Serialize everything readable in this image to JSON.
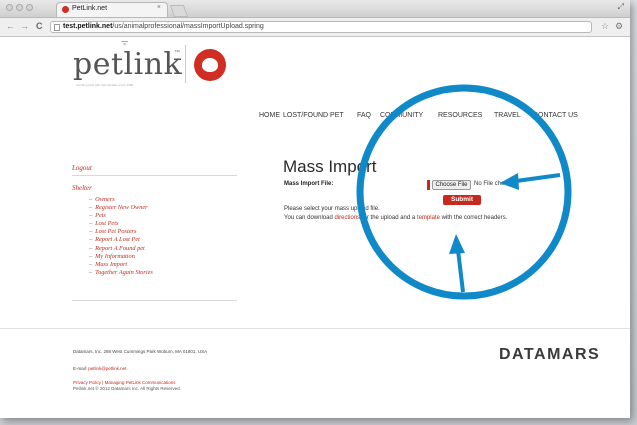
{
  "browser": {
    "tab_title": "PetLink.net",
    "tab_close": "×",
    "window_control": "⤢",
    "url_host": "test.petlink.net",
    "url_path": "/us/animalprofessional/massImportUpload.spring",
    "back_icon": "←",
    "forward_icon": "→",
    "reload_icon": "C",
    "star_icon": "☆",
    "wrench_icon": "⚙"
  },
  "site": {
    "logo_text": "petlink",
    "logo_tm": "™",
    "logo_tagline": "reuniting pets with their families since 1985",
    "brand_color": "#c8291e"
  },
  "nav": {
    "items": [
      "HOME",
      "LOST/FOUND PET",
      "FAQ",
      "COMMUNITY",
      "RESOURCES",
      "TRAVEL",
      "CONTACT US"
    ]
  },
  "sidebar": {
    "logout": "Logout",
    "shelter": "Shelter",
    "items": [
      "Owners",
      "Register New Owner",
      "Pets",
      "Lost Pets",
      "Lost Pet Posters",
      "Report A Lost Pet",
      "Report A Found pet",
      "My Information",
      "Mass Import",
      "Together Again Stories"
    ]
  },
  "main": {
    "title": "Mass Import",
    "field_label": "Mass Import File:",
    "choose_file": "Choose File",
    "no_file": "No File chosen",
    "submit": "Submit",
    "help_line1": "Please select your mass upload file.",
    "help_line2_pre": "You can download ",
    "help_link1": "directions",
    "help_line2_mid": " for the upload and a ",
    "help_link2": "template",
    "help_line2_post": " with the correct headers."
  },
  "footer": {
    "address": "Datamars, Inc. 288 West Cummings Park Woburn, MA 01801, USA",
    "email_label": "E-mail: ",
    "email": "petlink@petlink.net",
    "links": "Privacy Policy | Managing PetLink Communications",
    "copyright": "Petlink.net © 2012 Datamars Inc. All Rights Reserved.",
    "brand": "DATAMARS"
  },
  "annotation": {
    "circle_color": "#1089c9"
  }
}
